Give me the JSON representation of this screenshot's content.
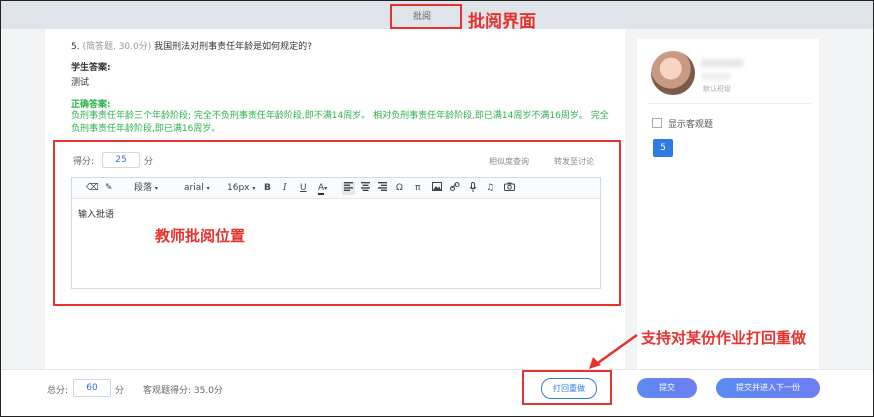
{
  "topbar": {
    "title": "批阅"
  },
  "annotations": {
    "review_ui": "批阅界面",
    "teacher_review_position": "教师批阅位置",
    "return_redo": "支持对某份作业打回重做"
  },
  "question": {
    "number": "5.",
    "meta": "(简答题, 30.0分)",
    "text": "我国刑法对刑事责任年龄是如何规定的?",
    "student_answer_label": "学生答案:",
    "student_answer": "测试",
    "correct_answer_label": "正确答案:",
    "correct_answer": "负刑事责任年龄三个年龄阶段; 完全不负刑事责任年龄阶段,即不满14周岁。 相对负刑事责任年龄阶段,即已满14周岁不满16周岁。 完全负刑事责任年龄阶段,即已满16周岁。"
  },
  "scoring": {
    "label": "得分:",
    "value": "25",
    "unit": "分",
    "similarity_link": "相似度查询",
    "forward_link": "转发至讨论"
  },
  "editor": {
    "toolbar": {
      "eraser": "⌫",
      "brush": "✎",
      "paragraph": "段落",
      "font": "arial",
      "size": "16px",
      "bold": "B",
      "italic": "I",
      "underline": "U",
      "font_color": "A",
      "omega": "Ω",
      "pi": "π"
    },
    "placeholder": "输入批语"
  },
  "sidebar": {
    "sub_text": "默认班级",
    "show_objective": "显示客观题",
    "question_number": "5"
  },
  "bottom": {
    "total_label": "总分:",
    "total_value": "60",
    "total_unit": "分",
    "objective_score": "客观题得分: 35.0分",
    "return_button": "打回重做",
    "submit_button": "提交",
    "submit_next_button": "提交并进入下一份"
  },
  "colors": {
    "accent": "#2f7be5",
    "annotation_red": "#e8322d",
    "correct_green": "#2bb24c"
  }
}
